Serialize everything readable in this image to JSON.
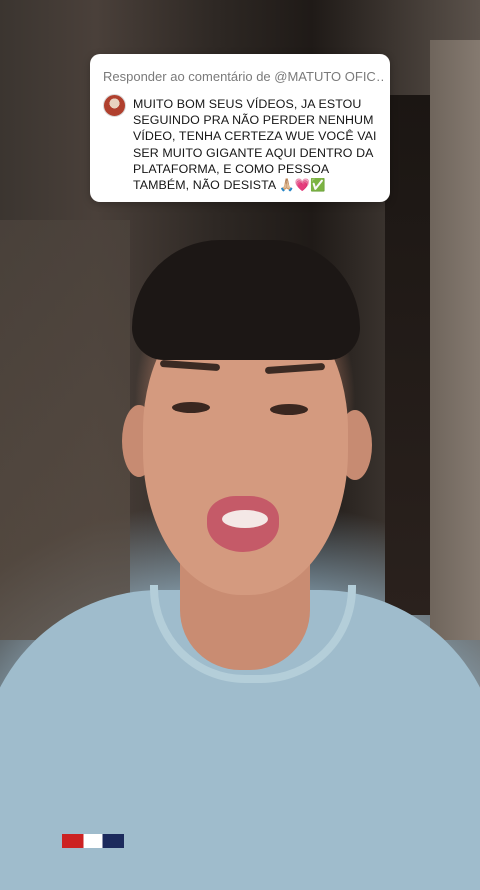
{
  "reply": {
    "header": "Responder ao comentário de @MATUTO OFIC…",
    "comment": "MUITO BOM SEUS VÍDEOS, JA ESTOU SEGUINDO PRA NÃO PERDER NENHUM VÍDEO, TENHA CERTEZA WUE VOCÊ VAI SER MUITO GIGANTE AQUI DENTRO DA PLATAFORMA, E COMO PESSOA TAMBÉM, NÃO DESISTA 🙏🏼💗✅",
    "avatar_icon": "profile-avatar"
  },
  "colors": {
    "card_bg": "#ffffff",
    "header_text": "#7a7a7a",
    "comment_text": "#161616"
  }
}
